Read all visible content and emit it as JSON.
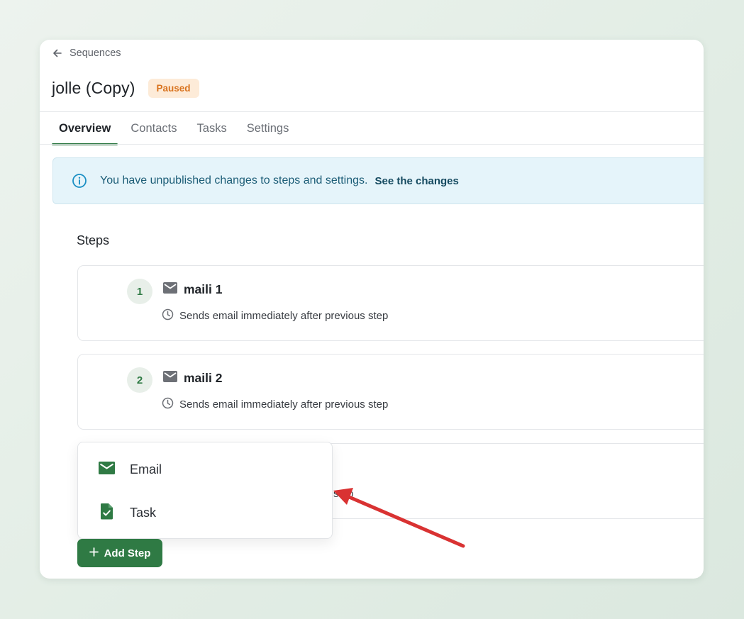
{
  "breadcrumb": {
    "label": "Sequences",
    "icon": "arrow-left-icon"
  },
  "sequence": {
    "title": "jolle (Copy)",
    "status": "Paused"
  },
  "tabs": [
    {
      "label": "Overview",
      "active": true
    },
    {
      "label": "Contacts",
      "active": false
    },
    {
      "label": "Tasks",
      "active": false
    },
    {
      "label": "Settings",
      "active": false
    }
  ],
  "banner": {
    "message": "You have unpublished changes to steps and settings.",
    "link": "See the changes",
    "icon": "info-icon"
  },
  "steps_section": {
    "title": "Steps",
    "steps": [
      {
        "number": "1",
        "name": "maili 1",
        "icon": "mail-icon",
        "timing": "Sends email immediately after previous step"
      },
      {
        "number": "2",
        "name": "maili 2",
        "icon": "mail-icon",
        "timing": "Sends email immediately after previous step"
      }
    ],
    "hidden_step_partial_text": "step"
  },
  "add_step_menu": {
    "items": [
      {
        "label": "Email",
        "icon": "mail-icon"
      },
      {
        "label": "Task",
        "icon": "task-file-icon"
      }
    ]
  },
  "add_step_button": {
    "label": "Add Step",
    "icon": "plus-icon"
  },
  "colors": {
    "brand_green": "#2f7a44",
    "paused_badge_bg": "#fdebd8",
    "paused_badge_text": "#d9731e",
    "banner_bg": "#e5f4fa",
    "annotation_arrow": "#d93232"
  }
}
